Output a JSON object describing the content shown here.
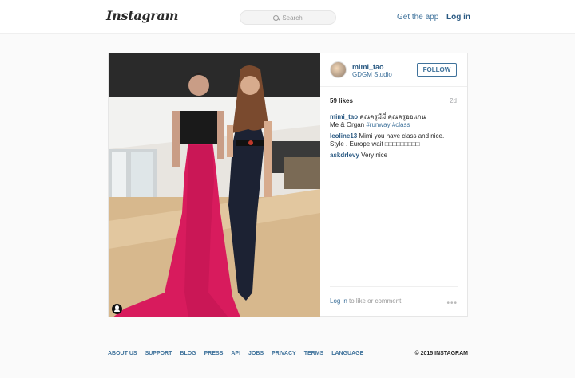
{
  "header": {
    "logo": "Instagram",
    "search_placeholder": "Search",
    "get_app": "Get the app",
    "login": "Log in"
  },
  "post": {
    "username": "mimi_tao",
    "location": "GDGM Studio",
    "follow_label": "FOLLOW",
    "likes": "59 likes",
    "age": "2d",
    "comments": [
      {
        "user": "mimi_tao",
        "text": " คุณครูมีมี่ คุณครูออแกน\nMe & Organ ",
        "tags": "#runway #class"
      },
      {
        "user": "leoline13",
        "text": " Mimi you have class and nice. Style . Europe wait □□□□□□□□□",
        "tags": ""
      },
      {
        "user": "askdrlevy",
        "text": " Very nice",
        "tags": ""
      }
    ],
    "login_link": "Log in",
    "login_suffix": " to like or comment.",
    "more": "•••"
  },
  "footer": {
    "links": [
      "ABOUT US",
      "SUPPORT",
      "BLOG",
      "PRESS",
      "API",
      "JOBS",
      "PRIVACY",
      "TERMS",
      "LANGUAGE"
    ],
    "copyright": "© 2015 INSTAGRAM"
  },
  "colors": {
    "link": "#3f729b",
    "dress": "#d81b5d"
  },
  "icons": [
    "search-icon",
    "user-tag-icon",
    "more-options-icon"
  ]
}
